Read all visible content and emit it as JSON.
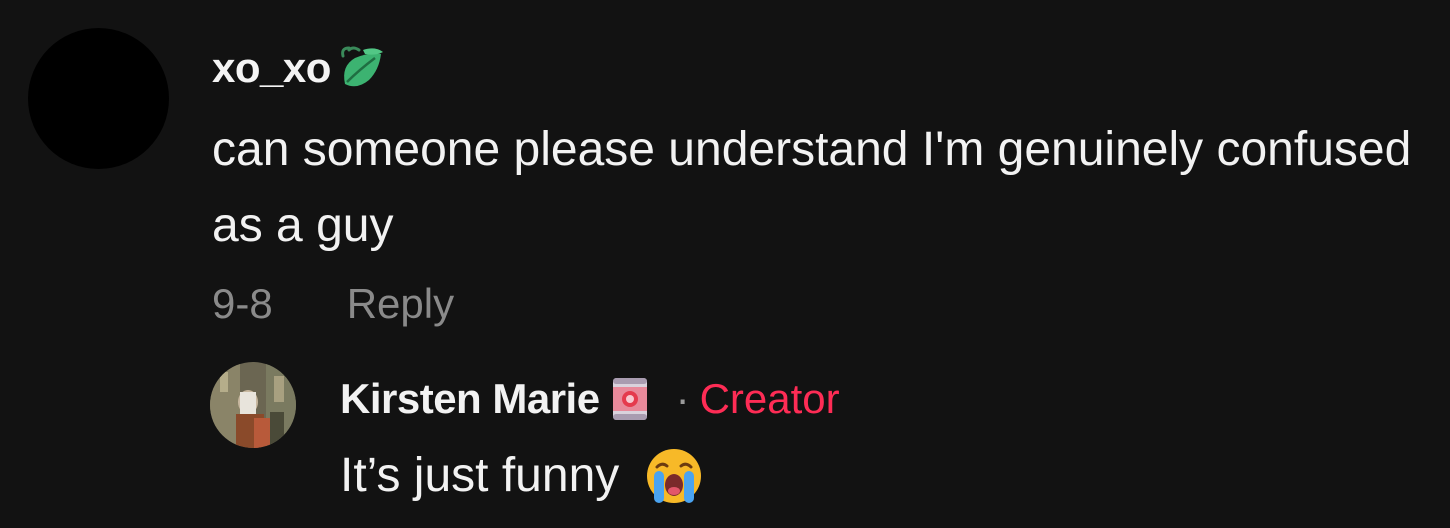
{
  "comment": {
    "username": "xo_xo",
    "username_icon": "leaf-emoji-icon",
    "text": "can someone please understand I'm genuinely confused as a guy",
    "date": "9-8",
    "reply_label": "Reply"
  },
  "reply": {
    "author": "Kirsten Marie",
    "author_icon": "tin-can-emoji-icon",
    "separator": "·",
    "badge": "Creator",
    "text": "It’s just funny",
    "text_icon": "crying-face-emoji-icon"
  },
  "colors": {
    "background": "#121212",
    "text": "#f2f2f2",
    "muted": "#8a8a8a",
    "creator": "#fe2c55"
  }
}
